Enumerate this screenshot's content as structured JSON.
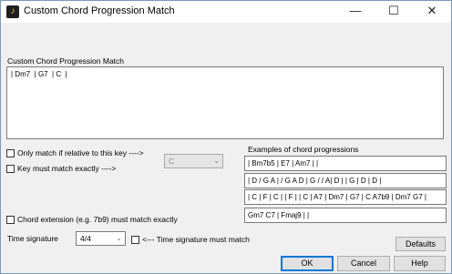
{
  "window": {
    "title": "Custom Chord Progression Match",
    "min_glyph": "—",
    "max_glyph": "☐",
    "close_glyph": "✕"
  },
  "progression": {
    "label": "Custom Chord Progression Match",
    "value": "| Dm7  | G7  | C  |"
  },
  "options": {
    "relative_key_label": "Only match if relative to this key ---->",
    "key_exact_label": "Key must match exactly ---->",
    "key_value": "C",
    "extension_label": "Chord extension (e.g. 7b9) must match exactly",
    "time_sig_label": "Time signature",
    "time_sig_value": "4/4",
    "time_sig_must_label": "<--- Time signature must match"
  },
  "examples": {
    "label": "Examples of chord progressions",
    "items": [
      "| Bm7b5 | E7 | Am7 |  |",
      "| D / G A | / G A D | G / / A| D | | G | D | D |",
      "| C | F | C |  | F |  | C | A7 | Dm7 | G7 | C A7b9 | Dm7 G7 |",
      "Gm7 C7 | Fmaj9 |  |"
    ]
  },
  "buttons": {
    "defaults": "Defaults",
    "ok": "OK",
    "cancel": "Cancel",
    "help": "Help"
  }
}
